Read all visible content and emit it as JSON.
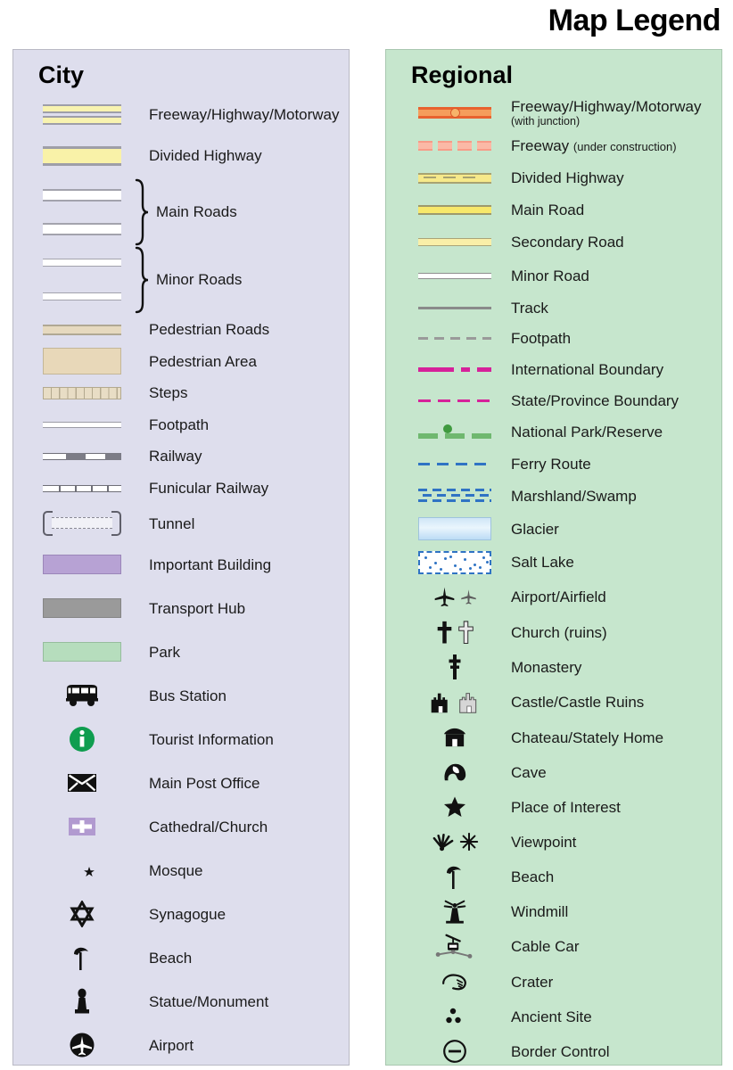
{
  "title": "Map Legend",
  "panels": {
    "city": {
      "heading": "City",
      "bg_color": "#dedeed",
      "items": [
        {
          "label": "Freeway/Highway/Motorway",
          "symbol": "city-freeway"
        },
        {
          "label": "Divided Highway",
          "symbol": "city-divided-highway"
        },
        {
          "label": "Main Roads",
          "symbol": "city-main-roads-group",
          "grouped": true
        },
        {
          "label": "Minor Roads",
          "symbol": "city-minor-roads-group",
          "grouped": true
        },
        {
          "label": "Pedestrian Roads",
          "symbol": "city-pedestrian-road"
        },
        {
          "label": "Pedestrian Area",
          "symbol": "city-pedestrian-area"
        },
        {
          "label": "Steps",
          "symbol": "city-steps"
        },
        {
          "label": "Footpath",
          "symbol": "city-footpath"
        },
        {
          "label": "Railway",
          "symbol": "city-railway"
        },
        {
          "label": "Funicular Railway",
          "symbol": "city-funicular-railway"
        },
        {
          "label": "Tunnel",
          "symbol": "city-tunnel"
        },
        {
          "label": "Important Building",
          "symbol": "city-important-building"
        },
        {
          "label": "Transport Hub",
          "symbol": "city-transport-hub"
        },
        {
          "label": "Park",
          "symbol": "city-park"
        },
        {
          "label": "Bus Station",
          "symbol": "bus-icon"
        },
        {
          "label": "Tourist Information",
          "symbol": "information-icon"
        },
        {
          "label": "Main Post Office",
          "symbol": "envelope-icon"
        },
        {
          "label": "Cathedral/Church",
          "symbol": "cathedral-icon"
        },
        {
          "label": "Mosque",
          "symbol": "crescent-star-icon"
        },
        {
          "label": "Synagogue",
          "symbol": "star-of-david-icon"
        },
        {
          "label": "Beach",
          "symbol": "beach-umbrella-icon"
        },
        {
          "label": "Statue/Monument",
          "symbol": "statue-icon"
        },
        {
          "label": "Airport",
          "symbol": "airport-circle-icon"
        }
      ]
    },
    "regional": {
      "heading": "Regional",
      "bg_color": "#c6e6cd",
      "items": [
        {
          "label": "Freeway/Highway/Motorway",
          "sublabel": "(with junction)",
          "symbol": "regional-freeway"
        },
        {
          "label": "Freeway",
          "inline_sublabel": "(under construction)",
          "symbol": "regional-freeway-under-construction"
        },
        {
          "label": "Divided Highway",
          "symbol": "regional-divided-highway"
        },
        {
          "label": "Main Road",
          "symbol": "regional-main-road"
        },
        {
          "label": "Secondary Road",
          "symbol": "regional-secondary-road"
        },
        {
          "label": "Minor Road",
          "symbol": "regional-minor-road"
        },
        {
          "label": "Track",
          "symbol": "regional-track"
        },
        {
          "label": "Footpath",
          "symbol": "regional-footpath"
        },
        {
          "label": "International Boundary",
          "symbol": "international-boundary"
        },
        {
          "label": "State/Province Boundary",
          "symbol": "state-boundary"
        },
        {
          "label": "National Park/Reserve",
          "symbol": "national-park-boundary"
        },
        {
          "label": "Ferry Route",
          "symbol": "ferry-route"
        },
        {
          "label": "Marshland/Swamp",
          "symbol": "marshland"
        },
        {
          "label": "Glacier",
          "symbol": "glacier"
        },
        {
          "label": "Salt Lake",
          "symbol": "salt-lake"
        },
        {
          "label": "Airport/Airfield",
          "symbol": "airplane-icon"
        },
        {
          "label": "Church (ruins)",
          "symbol": "cross-icon"
        },
        {
          "label": "Monastery",
          "symbol": "monastery-cross-icon"
        },
        {
          "label": "Castle/Castle Ruins",
          "symbol": "castle-icon"
        },
        {
          "label": "Chateau/Stately Home",
          "symbol": "chateau-icon"
        },
        {
          "label": "Cave",
          "symbol": "cave-icon"
        },
        {
          "label": "Place of Interest",
          "symbol": "star-icon"
        },
        {
          "label": "Viewpoint",
          "symbol": "viewpoint-icon"
        },
        {
          "label": "Beach",
          "symbol": "beach-umbrella-icon"
        },
        {
          "label": "Windmill",
          "symbol": "windmill-icon"
        },
        {
          "label": "Cable Car",
          "symbol": "cable-car-icon"
        },
        {
          "label": "Crater",
          "symbol": "crater-icon"
        },
        {
          "label": "Ancient Site",
          "symbol": "ancient-site-icon"
        },
        {
          "label": "Border Control",
          "symbol": "border-control-icon"
        }
      ]
    }
  },
  "colors": {
    "city_panel": "#dedeed",
    "regional_panel": "#c6e6cd",
    "freeway_yellow": "#f8f3b0",
    "regional_freeway_orange": "#f59d5c",
    "regional_freeway_casing": "#e8622f",
    "boundary_magenta": "#d6219a",
    "ferry_blue": "#2f73c4",
    "park_green": "#b6ddbd",
    "important_building_purple": "#b7a2d4",
    "transport_hub_gray": "#9a9a9a",
    "pedestrian_tan": "#e8d8b9",
    "tourist_info_green": "#0f9d4f"
  }
}
